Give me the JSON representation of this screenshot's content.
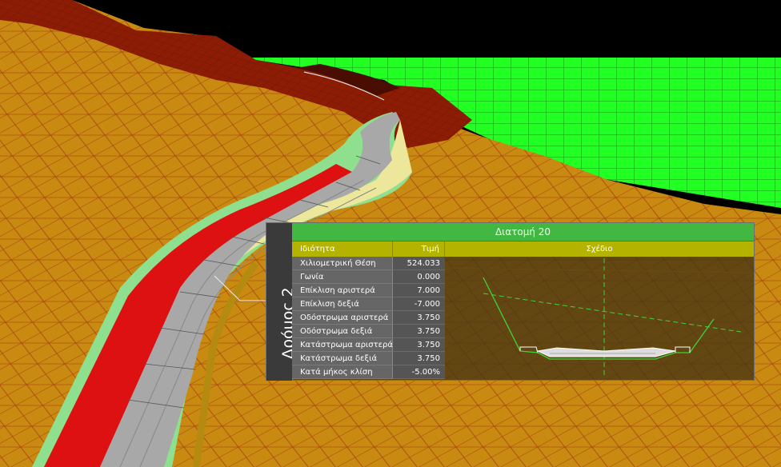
{
  "colors": {
    "sky": "#000000",
    "terrain": "#c98a12",
    "terrain_mesh": "#b23a12",
    "grid_green": "#22ff22",
    "road_grey": "#a8a8a8",
    "shoulder_red": "#dd1111",
    "verge_green": "#8ee08e",
    "slope_yellow": "#ece79a",
    "title_green": "#42b842",
    "header_yellow": "#b3b300"
  },
  "panel": {
    "road_name": "Δρόμος 2",
    "title": "Διατομή 20",
    "headers": {
      "property": "Ιδιότητα",
      "value": "Τιμή",
      "drawing": "Σχέδιο"
    },
    "rows": [
      {
        "label": "Χιλιομετρική Θέση",
        "value": "524.033"
      },
      {
        "label": "Γωνία",
        "value": "0.000"
      },
      {
        "label": "Επίκλιση αριστερά",
        "value": "7.000"
      },
      {
        "label": "Επίκλιση δεξιά",
        "value": "-7.000"
      },
      {
        "label": "Οδόστρωμα αριστερά",
        "value": "3.750"
      },
      {
        "label": "Οδόστρωμα δεξιά",
        "value": "3.750"
      },
      {
        "label": "Κατάστρωμα αριστερά",
        "value": "3.750"
      },
      {
        "label": "Κατάστρωμα δεξιά",
        "value": "3.750"
      },
      {
        "label": "Κατά μήκος κλίση",
        "value": "-5.00%"
      }
    ]
  }
}
